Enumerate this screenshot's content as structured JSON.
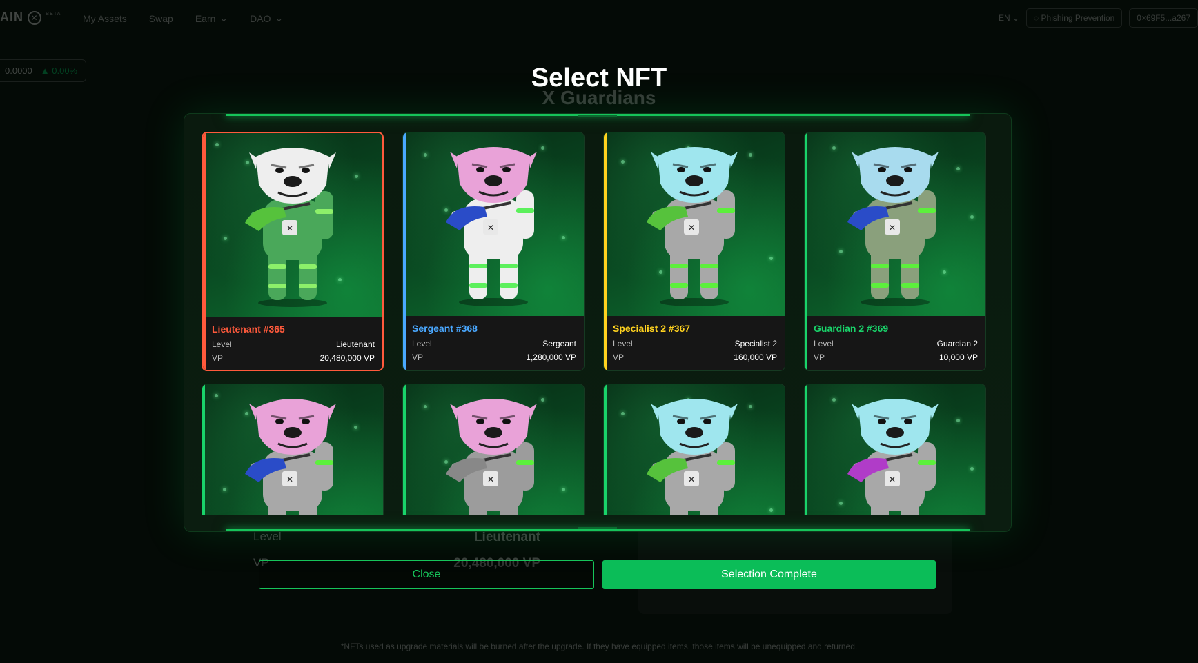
{
  "background": {
    "brand": {
      "text": "AIN",
      "beta": "BETA"
    },
    "nav": [
      {
        "label": "My Assets",
        "has_dropdown": false
      },
      {
        "label": "Swap",
        "has_dropdown": false
      },
      {
        "label": "Earn",
        "has_dropdown": true
      },
      {
        "label": "DAO",
        "has_dropdown": true
      }
    ],
    "language": "EN",
    "phishing_prevention": "Phishing Prevention",
    "wallet": "0×69F5...a267",
    "ticker": {
      "value": "0.0000",
      "change": "▲ 0.00%"
    },
    "subtitle": "X Guardians",
    "detail": {
      "level_label": "Level",
      "level_value": "Lieutenant",
      "vp_label": "VP",
      "vp_value": "20,480,000 VP"
    },
    "footnote": "*NFTs used as upgrade materials will be burned after the upgrade. If they have equipped items, those items will be unequipped and returned."
  },
  "modal": {
    "title": "Select NFT",
    "cards": [
      {
        "name": "Lieutenant #365",
        "color": "#ff5a3c",
        "level_label": "Level",
        "level": "Lieutenant",
        "vp_label": "VP",
        "vp": "20,480,000 VP",
        "selected": true,
        "head": "#eeeeee",
        "suit": "#4aa85a",
        "trim": "#8df06a",
        "gun": "#56c23c"
      },
      {
        "name": "Sergeant #368",
        "color": "#4aa8ff",
        "level_label": "Level",
        "level": "Sergeant",
        "vp_label": "VP",
        "vp": "1,280,000 VP",
        "selected": false,
        "head": "#e9a2d8",
        "suit": "#eeeeee",
        "trim": "#5cf05c",
        "gun": "#2a4cc8"
      },
      {
        "name": "Specialist 2 #367",
        "color": "#ffd21f",
        "level_label": "Level",
        "level": "Specialist 2",
        "vp_label": "VP",
        "vp": "160,000 VP",
        "selected": false,
        "head": "#9fe6ee",
        "suit": "#a8a8a8",
        "trim": "#5cf03c",
        "gun": "#56c23c"
      },
      {
        "name": "Guardian 2 #369",
        "color": "#19d36a",
        "level_label": "Level",
        "level": "Guardian 2",
        "vp_label": "VP",
        "vp": "10,000 VP",
        "selected": false,
        "head": "#a8dbee",
        "suit": "#8aa07c",
        "trim": "#5cf03c",
        "gun": "#2a4cc8"
      },
      {
        "name": "",
        "color": "#19d36a",
        "level_label": "",
        "level": "",
        "vp_label": "",
        "vp": "",
        "selected": false,
        "head": "#e9a2d8",
        "suit": "#a8a8a8",
        "trim": "#5cf03c",
        "gun": "#2a4cc8"
      },
      {
        "name": "",
        "color": "#19d36a",
        "level_label": "",
        "level": "",
        "vp_label": "",
        "vp": "",
        "selected": false,
        "head": "#e9a2d8",
        "suit": "#9c9c9c",
        "trim": "#5cf03c",
        "gun": "#888888"
      },
      {
        "name": "",
        "color": "#19d36a",
        "level_label": "",
        "level": "",
        "vp_label": "",
        "vp": "",
        "selected": false,
        "head": "#9fe6ee",
        "suit": "#a8a8a8",
        "trim": "#5cf03c",
        "gun": "#56c23c"
      },
      {
        "name": "",
        "color": "#19d36a",
        "level_label": "",
        "level": "",
        "vp_label": "",
        "vp": "",
        "selected": false,
        "head": "#9fe6ee",
        "suit": "#a8a8a8",
        "trim": "#5cf03c",
        "gun": "#b03cc8"
      }
    ],
    "close_label": "Close",
    "complete_label": "Selection Complete"
  }
}
